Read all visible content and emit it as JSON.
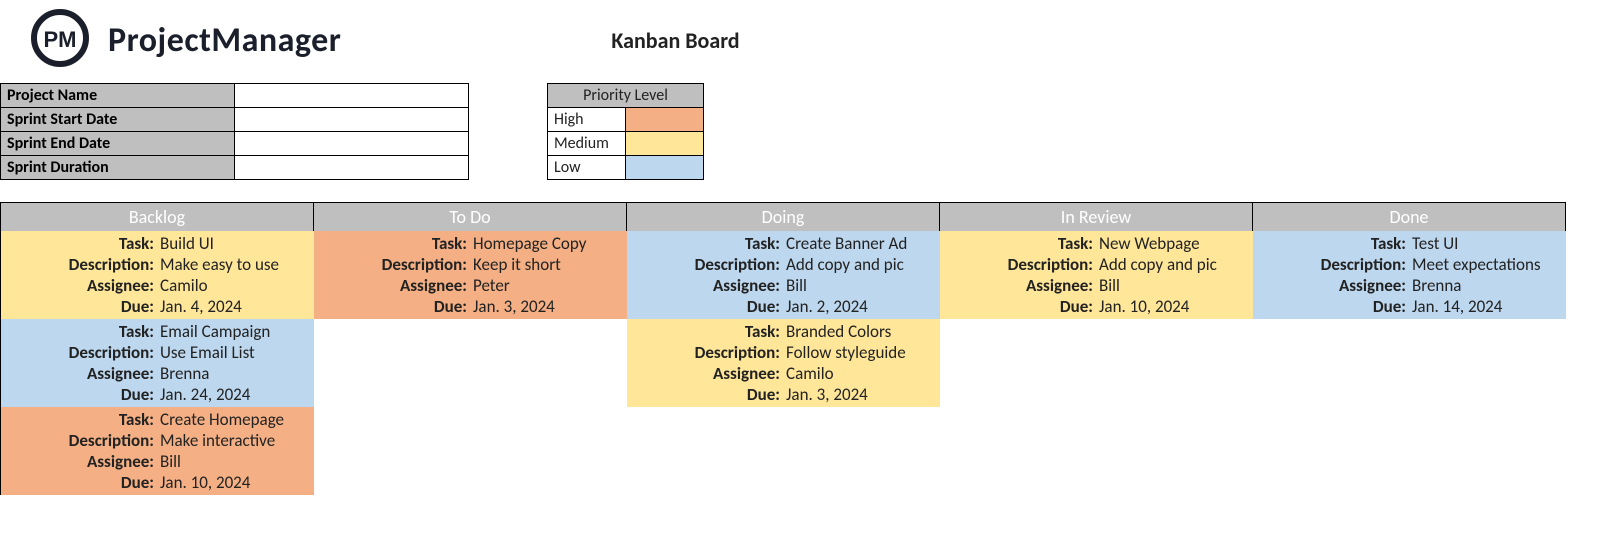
{
  "brand": "ProjectManager",
  "page_title": "Kanban Board",
  "colors": {
    "header_grey": "#bfbfbf",
    "high": "#f4b084",
    "medium": "#ffe699",
    "low": "#bdd7ee"
  },
  "meta_fields": {
    "project_name_label": "Project Name",
    "sprint_start_label": "Sprint Start Date",
    "sprint_end_label": "Sprint End Date",
    "sprint_duration_label": "Sprint Duration",
    "project_name": "",
    "sprint_start": "",
    "sprint_end": "",
    "sprint_duration": ""
  },
  "legend": {
    "title": "Priority Level",
    "high": "High",
    "medium": "Medium",
    "low": "Low"
  },
  "labels": {
    "task": "Task:",
    "description": "Description:",
    "assignee": "Assignee:",
    "due": "Due:"
  },
  "columns": [
    {
      "name": "Backlog",
      "cards": [
        {
          "priority": "medium",
          "task": "Build UI",
          "description": "Make easy to use",
          "assignee": "Camilo",
          "due": "Jan. 4, 2024"
        },
        {
          "priority": "low",
          "task": "Email Campaign",
          "description": "Use Email List",
          "assignee": "Brenna",
          "due": "Jan. 24, 2024"
        },
        {
          "priority": "high",
          "task": "Create Homepage",
          "description": "Make interactive",
          "assignee": "Bill",
          "due": "Jan. 10, 2024"
        }
      ]
    },
    {
      "name": "To Do",
      "cards": [
        {
          "priority": "high",
          "task": "Homepage Copy",
          "description": "Keep it short",
          "assignee": "Peter",
          "due": "Jan. 3, 2024"
        }
      ]
    },
    {
      "name": "Doing",
      "cards": [
        {
          "priority": "low",
          "task": "Create Banner Ad",
          "description": "Add copy and pic",
          "assignee": "Bill",
          "due": "Jan. 2, 2024"
        },
        {
          "priority": "medium",
          "task": "Branded Colors",
          "description": "Follow styleguide",
          "assignee": "Camilo",
          "due": "Jan. 3, 2024"
        }
      ]
    },
    {
      "name": "In Review",
      "cards": [
        {
          "priority": "medium",
          "task": "New Webpage",
          "description": "Add copy and pic",
          "assignee": "Bill",
          "due": "Jan. 10, 2024"
        }
      ]
    },
    {
      "name": "Done",
      "cards": [
        {
          "priority": "low",
          "task": "Test UI",
          "description": "Meet expectations",
          "assignee": "Brenna",
          "due": "Jan. 14, 2024"
        }
      ]
    }
  ],
  "chart_data": {
    "type": "table",
    "title": "Kanban Board",
    "columns": [
      "Backlog",
      "To Do",
      "Doing",
      "In Review",
      "Done"
    ],
    "rows": [
      [
        "Build UI (Medium)",
        "Homepage Copy (High)",
        "Create Banner Ad (Low)",
        "New Webpage (Medium)",
        "Test UI (Low)"
      ],
      [
        "Email Campaign (Low)",
        "",
        "Branded Colors (Medium)",
        "",
        ""
      ],
      [
        "Create Homepage (High)",
        "",
        "",
        "",
        ""
      ]
    ]
  }
}
